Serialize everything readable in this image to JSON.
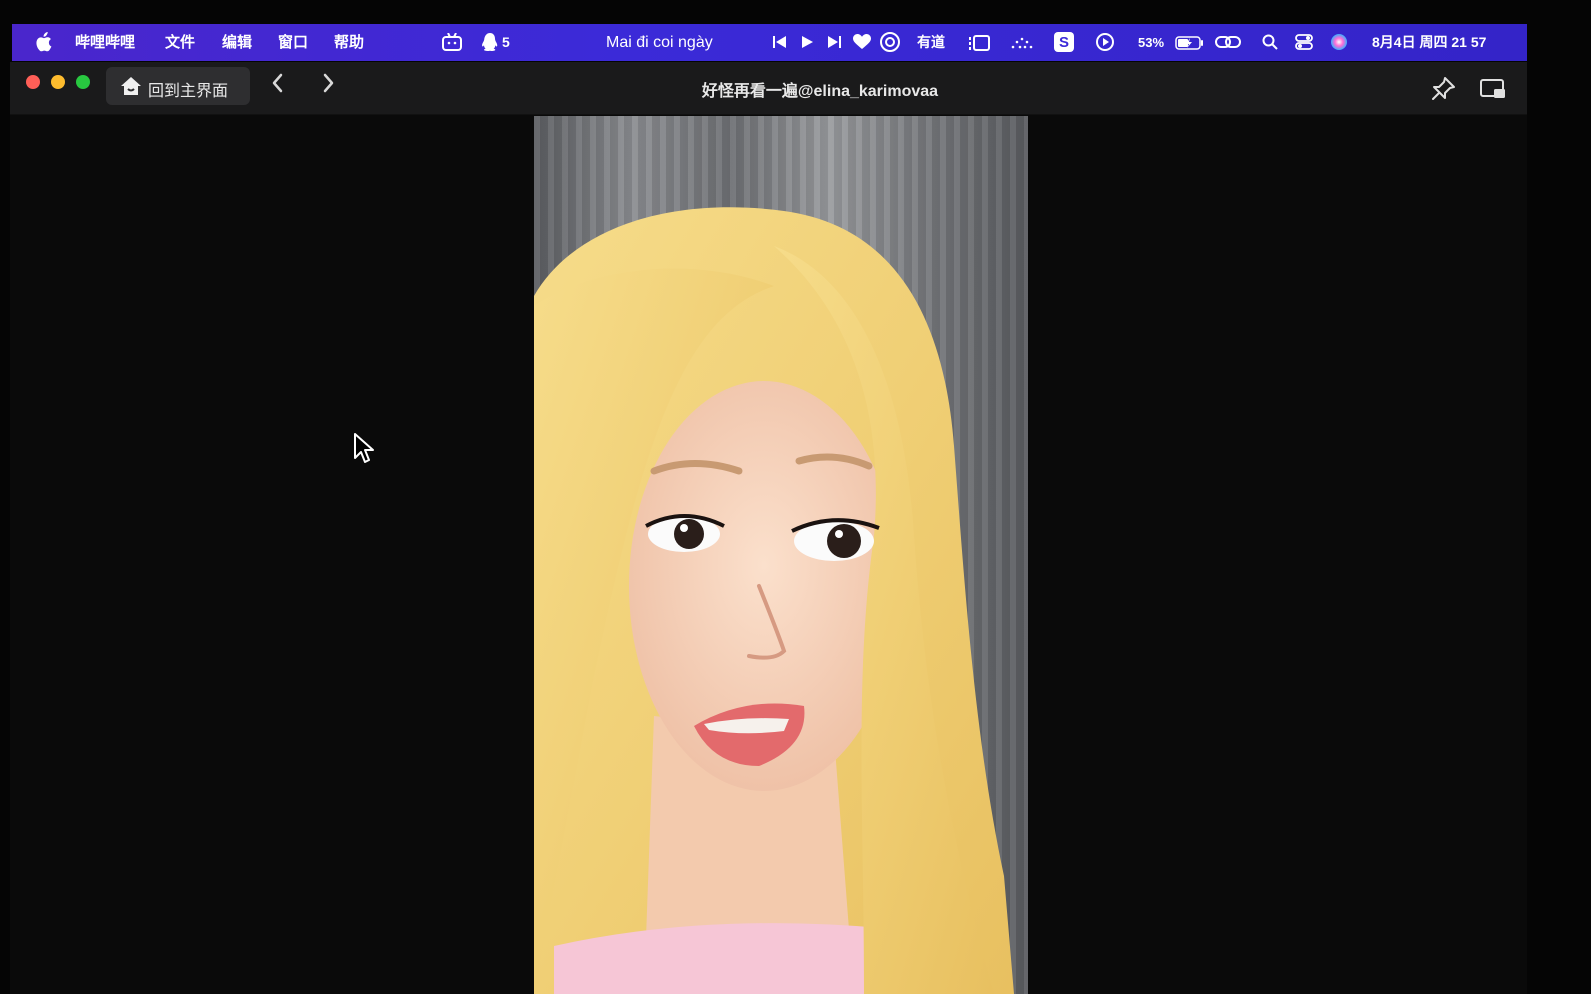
{
  "menubar": {
    "app_name": "哔哩哔哩",
    "menus": [
      "文件",
      "编辑",
      "窗口",
      "帮助"
    ],
    "notification_count": "5",
    "now_playing": "Mai đi coi ngày",
    "youdao_label": "有道",
    "battery_percent": "53%",
    "datetime": "8月4日 周四 21 57",
    "accent_color": "#3b2ad8"
  },
  "window": {
    "home_button_label": "回到主界面",
    "title": "好怪再看一遍@elina_karimovaa"
  }
}
